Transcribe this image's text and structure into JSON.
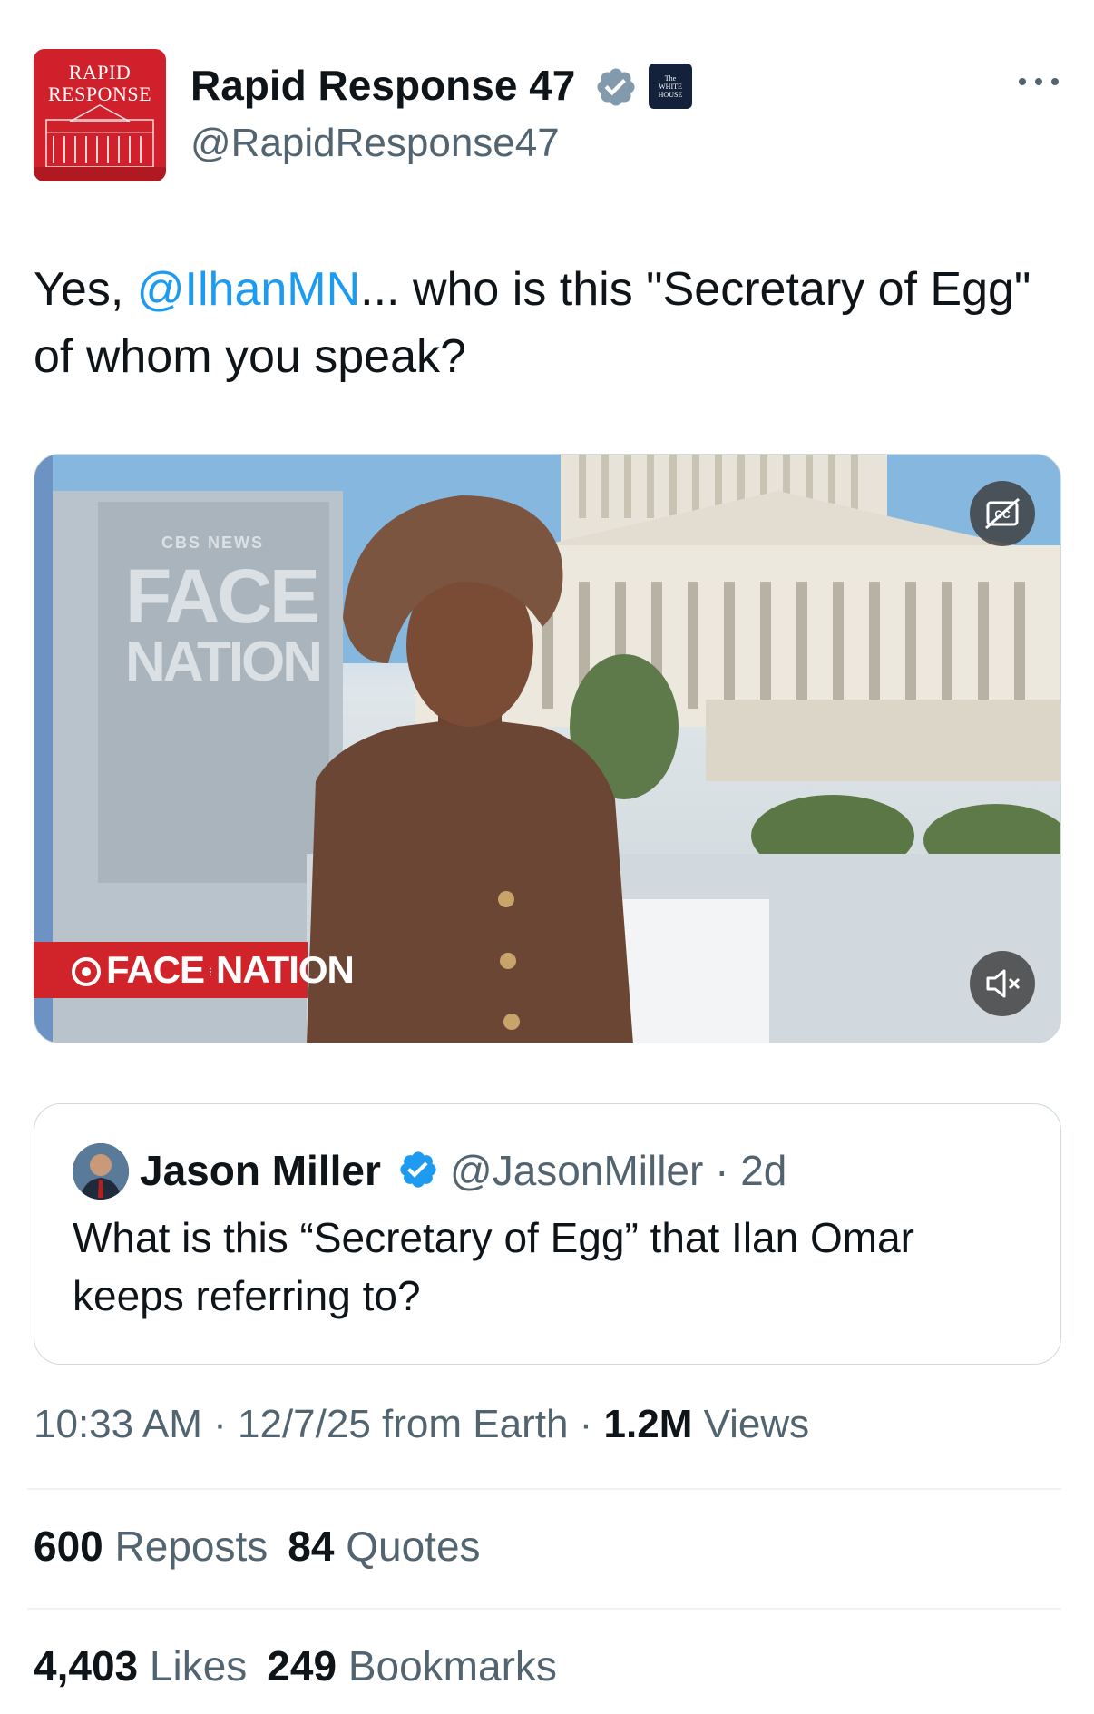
{
  "author": {
    "display_name": "Rapid Response 47",
    "handle": "@RapidResponse47",
    "avatar_text_line1": "RAPID",
    "avatar_text_line2": "RESPONSE",
    "affiliate_badge_text_line1": "The",
    "affiliate_badge_text_line2": "WHITE",
    "affiliate_badge_text_line3": "HOUSE",
    "verified": true
  },
  "tweet": {
    "text_prefix": "Yes, ",
    "mention": "@IlhanMN",
    "text_suffix": "... who is this \"Secretary of Egg\" of whom you speak?"
  },
  "video": {
    "chyron_part1": "FACE",
    "chyron_part2": "NATION",
    "background_sign_line1": "CBS NEWS",
    "background_sign_line2": "FACE",
    "background_sign_line3": "NATION",
    "caption_button_label": "CC",
    "muted": true
  },
  "quote": {
    "name": "Jason Miller",
    "handle": "@JasonMiller",
    "separator": " · ",
    "age": "2d",
    "text": "What is this “Secretary of Egg” that Ilan Omar keeps referring to?"
  },
  "meta": {
    "time": "10:33 AM",
    "sep1": " · ",
    "date_source": "12/7/25 from Earth",
    "sep2": " · ",
    "views_count": "1.2M",
    "views_label": " Views"
  },
  "stats": {
    "reposts_count": "600",
    "reposts_label": " Reposts",
    "quotes_count": "84",
    "quotes_label": " Quotes",
    "likes_count": "4,403",
    "likes_label": " Likes",
    "bookmarks_count": "249",
    "bookmarks_label": " Bookmarks"
  },
  "colors": {
    "link": "#1d9bf0",
    "secondary_text": "#536471",
    "brand_red": "#d0202c"
  }
}
